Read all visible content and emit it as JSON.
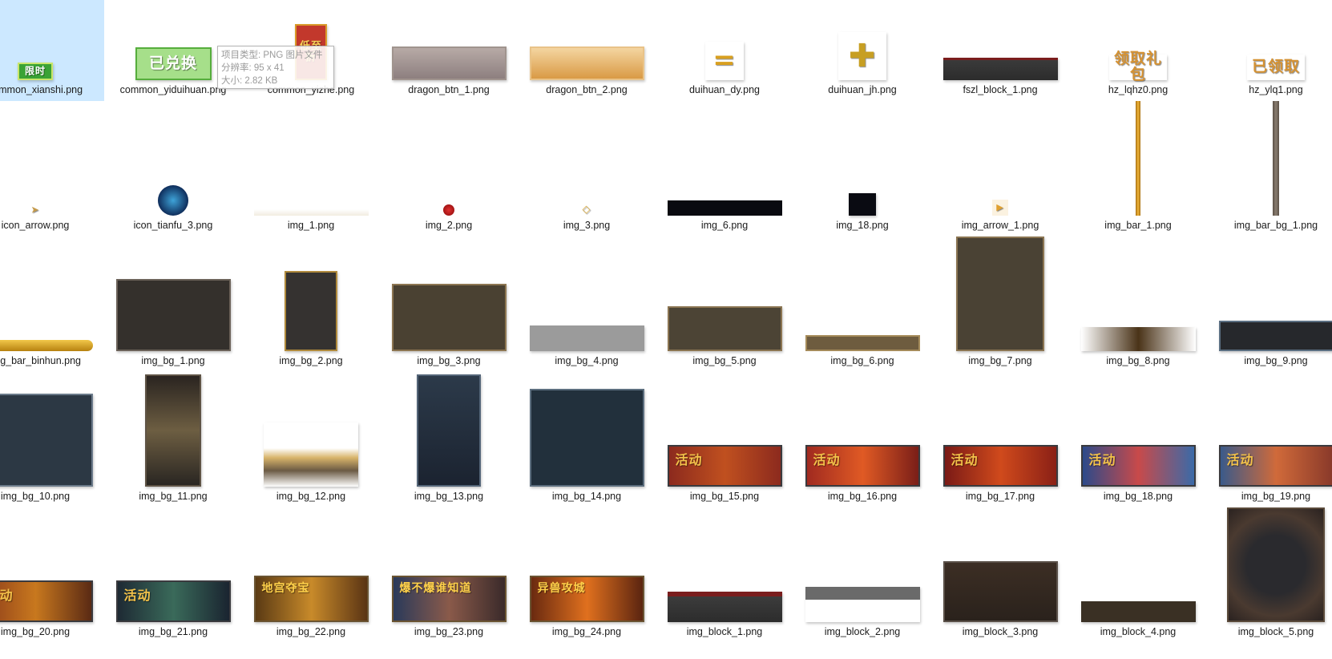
{
  "files": [
    {
      "name": "common_xianshi.png",
      "selected": true,
      "art": {
        "w": 44,
        "h": 22,
        "bg": "#3aa335",
        "border": "#c9e66a",
        "text": "限时",
        "fg": "#ffffff",
        "fs": 12
      }
    },
    {
      "name": "common_yiduihuan.png",
      "art": {
        "w": 95,
        "h": 41,
        "bg": "#a6df8a",
        "border": "#56ae3d",
        "text": "已兑换",
        "fg": "#ffffff",
        "fs": 19
      }
    },
    {
      "name": "common_yizhe.png",
      "art": {
        "w": 40,
        "h": 70,
        "bg": "#c2382c",
        "border": "#d99a2a",
        "text": "低至 折",
        "fg": "#f8d25a",
        "fs": 13
      }
    },
    {
      "name": "dragon_btn_1.png",
      "art": {
        "w": 143,
        "h": 42,
        "bg": "linear-gradient(#b7aaa6,#8d7f7f)",
        "border": "#a0948e"
      }
    },
    {
      "name": "dragon_btn_2.png",
      "art": {
        "w": 143,
        "h": 42,
        "bg": "linear-gradient(#f4d5a0,#d99a45)",
        "border": "#e9c388"
      }
    },
    {
      "name": "duihuan_dy.png",
      "art": {
        "w": 48,
        "h": 48,
        "bg": "#ffffff",
        "text": "=",
        "fg": "#d9a020",
        "fs": 34
      }
    },
    {
      "name": "duihuan_jh.png",
      "art": {
        "w": 60,
        "h": 60,
        "bg": "#ffffff",
        "text": "✚",
        "fg": "#c79f23",
        "fs": 40
      }
    },
    {
      "name": "fszl_block_1.png",
      "art": {
        "w": 143,
        "h": 28,
        "bg": "linear-gradient(#7a1d1d 0,#7a1d1d 3px,#3a3a3a 3px,#2c2c2c)"
      }
    },
    {
      "name": "hz_lqhz0.png",
      "art": {
        "w": 72,
        "h": 32,
        "bg": "#ffffff",
        "text": "领取礼包",
        "fg": "#d59233",
        "fs": 19
      }
    },
    {
      "name": "hz_ylq1.png",
      "art": {
        "w": 72,
        "h": 32,
        "bg": "#ffffff",
        "text": "已领取",
        "fg": "#d59233",
        "fs": 19
      }
    },
    {
      "name": "icon_arrow.png",
      "art": {
        "w": 14,
        "h": 14,
        "bg": "#ffffff",
        "text": "➤",
        "fg": "#c59a4a",
        "fs": 12
      }
    },
    {
      "name": "icon_tianfu_3.png",
      "art": {
        "w": 38,
        "h": 38,
        "bg": "radial-gradient(circle,#3ea3d8,#0f2e5c 70%)",
        "round": true
      }
    },
    {
      "name": "img_1.png",
      "art": {
        "w": 143,
        "h": 8,
        "bg": "linear-gradient(#ffffff,#f2ece0)"
      }
    },
    {
      "name": "img_2.png",
      "art": {
        "w": 14,
        "h": 14,
        "bg": "radial-gradient(circle,#e03030,#8a0808)",
        "round": true
      }
    },
    {
      "name": "img_3.png",
      "art": {
        "w": 14,
        "h": 14,
        "bg": "#ffffff",
        "text": "◇",
        "fg": "#e0b040",
        "fs": 13
      }
    },
    {
      "name": "img_6.png",
      "art": {
        "w": 143,
        "h": 19,
        "bg": "#090a10"
      }
    },
    {
      "name": "img_18.png",
      "art": {
        "w": 34,
        "h": 28,
        "bg": "#0a0b12"
      }
    },
    {
      "name": "img_arrow_1.png",
      "art": {
        "w": 20,
        "h": 20,
        "bg": "#fbf2e0",
        "text": "▶",
        "fg": "#e0a030",
        "fs": 11
      }
    },
    {
      "name": "img_bar_1.png",
      "art": {
        "w": 6,
        "h": 143,
        "bg": "linear-gradient(90deg,#a56d10,#f0b53a,#a56d10)"
      }
    },
    {
      "name": "img_bar_bg_1.png",
      "art": {
        "w": 8,
        "h": 143,
        "bg": "linear-gradient(90deg,#5b5046,#8a7d70,#5b5046)"
      }
    },
    {
      "name": "img_bar_binhun.png",
      "art": {
        "w": 143,
        "h": 14,
        "bg": "linear-gradient(#f2c84a,#b78210)",
        "round": true
      }
    },
    {
      "name": "img_bg_1.png",
      "art": {
        "w": 143,
        "h": 90,
        "bg": "#34302c",
        "border": "#6b6259"
      }
    },
    {
      "name": "img_bg_2.png",
      "art": {
        "w": 66,
        "h": 100,
        "bg": "#353230",
        "border": "#b08a3c"
      }
    },
    {
      "name": "img_bg_3.png",
      "art": {
        "w": 143,
        "h": 84,
        "bg": "#4a4132",
        "border": "#8c7551"
      }
    },
    {
      "name": "img_bg_4.png",
      "art": {
        "w": 143,
        "h": 32,
        "bg": "#9b9b9b"
      }
    },
    {
      "name": "img_bg_5.png",
      "art": {
        "w": 143,
        "h": 56,
        "bg": "#4c4435",
        "border": "#8b7552"
      }
    },
    {
      "name": "img_bg_6.png",
      "art": {
        "w": 143,
        "h": 20,
        "bg": "#6e5c3f",
        "border": "#a58b5a"
      }
    },
    {
      "name": "img_bg_7.png",
      "art": {
        "w": 110,
        "h": 143,
        "bg": "#4a4234",
        "border": "#8b7552"
      }
    },
    {
      "name": "img_bg_8.png",
      "art": {
        "w": 143,
        "h": 30,
        "bg": "linear-gradient(90deg,#ffffff,#4a3318 50%,#ffffff)"
      }
    },
    {
      "name": "img_bg_9.png",
      "art": {
        "w": 143,
        "h": 38,
        "bg": "#26282c",
        "border": "#5b6f82"
      }
    },
    {
      "name": "img_bg_10.png",
      "art": {
        "w": 143,
        "h": 116,
        "bg": "#2c3844",
        "border": "#6b7a8a"
      }
    },
    {
      "name": "img_bg_11.png",
      "art": {
        "w": 70,
        "h": 140,
        "bg": "linear-gradient(#2a2420,#6d5e42 50%,#2a2622)",
        "border": "#5e5345"
      }
    },
    {
      "name": "img_bg_12.png",
      "art": {
        "w": 118,
        "h": 80,
        "bg": "linear-gradient(#ffffff 40%,#d8b46a 55%,#6b5a44 75%,#ffffff)"
      }
    },
    {
      "name": "img_bg_13.png",
      "art": {
        "w": 80,
        "h": 140,
        "bg": "linear-gradient(#2c3a4a,#1b2330)",
        "border": "#546578"
      }
    },
    {
      "name": "img_bg_14.png",
      "art": {
        "w": 143,
        "h": 122,
        "bg": "#22303c",
        "border": "#5c6e7e"
      }
    },
    {
      "name": "img_bg_15.png",
      "art": {
        "w": 143,
        "h": 52,
        "bg": "linear-gradient(90deg,#8c2a1e,#c0501f,#8c2a1e)",
        "border": "#3a3a3e",
        "text": "活动",
        "fg": "#f3c24a",
        "fs": 16,
        "left": true
      }
    },
    {
      "name": "img_bg_16.png",
      "art": {
        "w": 143,
        "h": 52,
        "bg": "linear-gradient(90deg,#a02a20,#e05a24,#7a1e18)",
        "border": "#3a3a3e",
        "text": "活动",
        "fg": "#f3c24a",
        "fs": 16,
        "left": true
      }
    },
    {
      "name": "img_bg_17.png",
      "art": {
        "w": 143,
        "h": 52,
        "bg": "linear-gradient(90deg,#7a1a16,#d04a1c,#8a2016)",
        "border": "#3a3a3e",
        "text": "活动",
        "fg": "#f3c24a",
        "fs": 16,
        "left": true
      }
    },
    {
      "name": "img_bg_18.png",
      "art": {
        "w": 143,
        "h": 52,
        "bg": "linear-gradient(90deg,#2c4a8a,#c84a4a,#3a6aa8)",
        "border": "#3a3a3e",
        "text": "活动",
        "fg": "#f3c24a",
        "fs": 16,
        "left": true
      }
    },
    {
      "name": "img_bg_19.png",
      "art": {
        "w": 143,
        "h": 52,
        "bg": "linear-gradient(90deg,#3a5a8a,#d06a3a,#8a3a2a)",
        "border": "#3a3a3e",
        "text": "活动",
        "fg": "#f3c24a",
        "fs": 16,
        "left": true
      }
    },
    {
      "name": "img_bg_20.png",
      "art": {
        "w": 143,
        "h": 52,
        "bg": "linear-gradient(90deg,#8a3a1a,#c8781e,#5a2a14)",
        "border": "#3a3a3e",
        "text": "活动",
        "fg": "#f3c24a",
        "fs": 16,
        "left": true
      }
    },
    {
      "name": "img_bg_21.png",
      "art": {
        "w": 143,
        "h": 52,
        "bg": "linear-gradient(90deg,#1e2a34,#3a6a5a,#1a2430)",
        "border": "#3a3a3e",
        "text": "活动",
        "fg": "#f3c24a",
        "fs": 16,
        "left": true
      }
    },
    {
      "name": "img_bg_22.png",
      "art": {
        "w": 143,
        "h": 58,
        "bg": "linear-gradient(90deg,#5a3a14,#c88a2a,#5a3414)",
        "border": "#6a5432",
        "text": "地宫夺宝",
        "fg": "#ffd14a",
        "fs": 14,
        "left": true
      }
    },
    {
      "name": "img_bg_23.png",
      "art": {
        "w": 143,
        "h": 58,
        "bg": "linear-gradient(90deg,#2a3a5a,#8a5a4a,#3a2a2a)",
        "border": "#6a5432",
        "text": "爆不爆谁知道",
        "fg": "#ffd14a",
        "fs": 14,
        "left": true
      }
    },
    {
      "name": "img_bg_24.png",
      "art": {
        "w": 143,
        "h": 58,
        "bg": "linear-gradient(90deg,#6a2a10,#e0701e,#5a2410)",
        "border": "#6a5432",
        "text": "异兽攻城",
        "fg": "#ffd14a",
        "fs": 14,
        "left": true
      }
    },
    {
      "name": "img_block_1.png",
      "art": {
        "w": 143,
        "h": 38,
        "bg": "linear-gradient(#7a1d1d 0,#7a1d1d 6px,#3c3c3c 6px,#2c2c2c)"
      }
    },
    {
      "name": "img_block_2.png",
      "art": {
        "w": 143,
        "h": 44,
        "bg": "linear-gradient(#6a6a6a 0,#6a6a6a 16px,#ffffff 16px)"
      }
    },
    {
      "name": "img_block_3.png",
      "art": {
        "w": 143,
        "h": 76,
        "bg": "linear-gradient(#3c2e24,#2a221c)",
        "border": "#5a5048"
      }
    },
    {
      "name": "img_block_4.png",
      "art": {
        "w": 143,
        "h": 26,
        "bg": "#3a3024"
      }
    },
    {
      "name": "img_block_5.png",
      "art": {
        "w": 122,
        "h": 143,
        "bg": "radial-gradient(circle,#2a2a2e 40%,#4a3a30 70%,#2a2220)",
        "border": "#5a4a3a"
      }
    }
  ],
  "tooltip": {
    "type": "项目类型: PNG 图片文件",
    "resolution": "分辨率: 95 x 41",
    "size": "大小: 2.82 KB"
  }
}
